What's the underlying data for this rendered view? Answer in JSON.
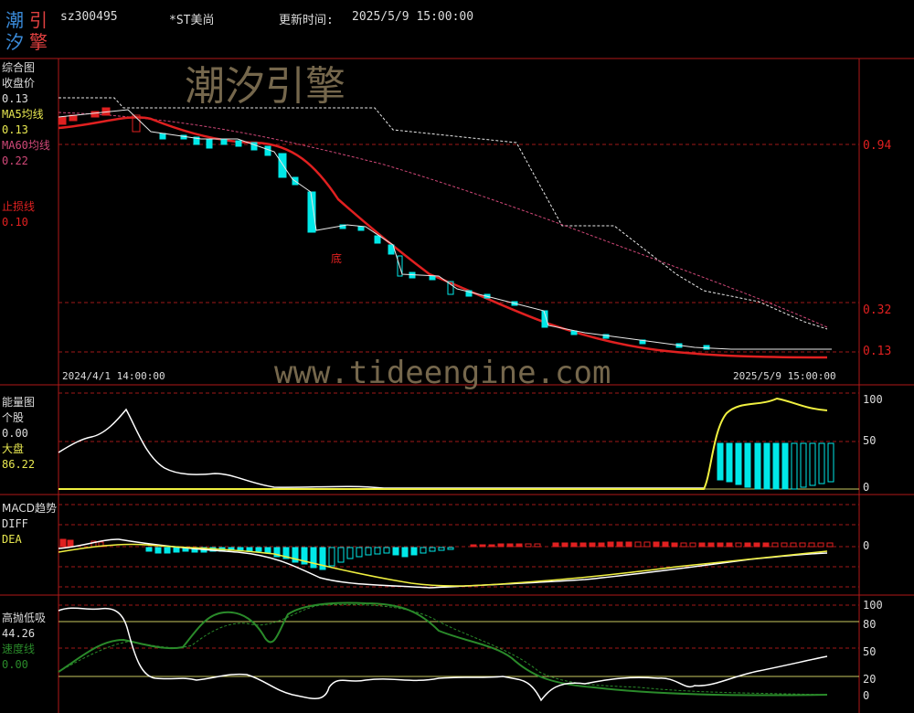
{
  "header": {
    "logo": {
      "chars": [
        "潮",
        "引",
        "汐",
        "擎"
      ]
    },
    "code": "sz300495",
    "name": "*ST美尚",
    "update_label": "更新时间:",
    "update_time": "2025/5/9 15:00:00"
  },
  "watermark": {
    "title": "潮汐引擎",
    "url": "www.tideengine.com"
  },
  "colors": {
    "red": "#e02020",
    "cyan": "#00e8e8",
    "yellow": "#e8e850",
    "pink": "#d04878",
    "white": "#ffffff",
    "green": "#2a8a2a",
    "grid": "#a01818"
  },
  "main_panel": {
    "title": "综合图",
    "close_label": "收盘价",
    "close_value": "0.13",
    "ma5_label": "MA5均线",
    "ma5_value": "0.13",
    "ma60_label": "MA60均线",
    "ma60_value": "0.22",
    "stop_label": "止损线",
    "stop_value": "0.10",
    "bottom_marker": "底",
    "start_date": "2024/4/1 14:00:00",
    "end_date": "2025/5/9 15:00:00",
    "price_axis": [
      "0.94",
      "0.32",
      "0.13"
    ]
  },
  "energy_panel": {
    "title": "能量图",
    "stock_label": "个股",
    "stock_value": "0.00",
    "market_label": "大盘",
    "market_value": "86.22",
    "axis": [
      "100",
      "50",
      "0"
    ]
  },
  "macd_panel": {
    "title": "MACD趋势",
    "diff_label": "DIFF",
    "dea_label": "DEA",
    "axis": [
      "0"
    ]
  },
  "oscillator_panel": {
    "title": "高抛低吸",
    "value": "44.26",
    "speed_label": "速度线",
    "speed_value": "0.00",
    "axis": [
      "100",
      "80",
      "50",
      "20",
      "0"
    ]
  }
}
